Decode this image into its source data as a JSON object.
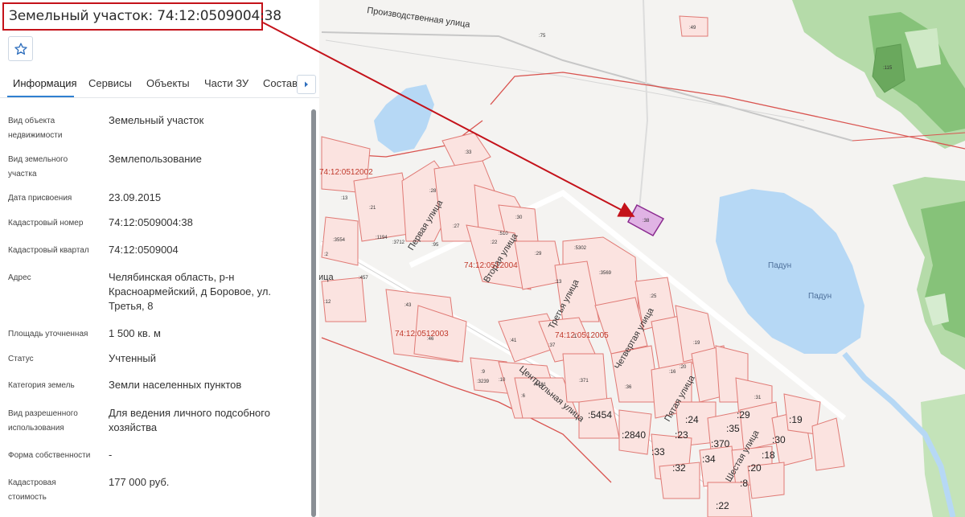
{
  "header": {
    "title": "Земельный участок: 74:12:0509004:38",
    "favorite_icon": "star-outline-icon"
  },
  "tabs": [
    {
      "label": "Информация",
      "active": true
    },
    {
      "label": "Сервисы",
      "active": false
    },
    {
      "label": "Объекты",
      "active": false
    },
    {
      "label": "Части ЗУ",
      "active": false
    },
    {
      "label": "Состав",
      "active": false
    }
  ],
  "tabs_scroll_icon": "chevron-right-icon",
  "info": [
    {
      "label": "Вид объекта недвижимости",
      "value": "Земельный участок"
    },
    {
      "label": "Вид земельного участка",
      "value": "Землепользование"
    },
    {
      "label": "Дата присвоения",
      "value": "23.09.2015"
    },
    {
      "label": "Кадастровый номер",
      "value": "74:12:0509004:38"
    },
    {
      "label": "Кадастровый квартал",
      "value": "74:12:0509004"
    },
    {
      "label": "Адрес",
      "value": "Челябинская область, р-н Красноармейский, д Боровое, ул. Третья, 8"
    },
    {
      "label": "Площадь уточненная",
      "value": "1 500 кв. м"
    },
    {
      "label": "Статус",
      "value": "Учтенный"
    },
    {
      "label": "Категория земель",
      "value": "Земли населенных пунктов"
    },
    {
      "label": "Вид разрешенного использования",
      "value": "Для ведения личного подсобного хозяйства"
    },
    {
      "label": "Форма собственности",
      "value": "-"
    },
    {
      "label": "Кадастровая стоимость",
      "value": "177 000 руб."
    }
  ],
  "map": {
    "streets": {
      "proizv": "Производственная улица",
      "pervaya": "Первая улица",
      "vtoraya": "Вторая улица",
      "tretya": "Третья улица",
      "chetv": "Четвертая улица",
      "pyataya": "Пятая улица",
      "shestaya": "Шестая улица",
      "centr": "Центральная улица"
    },
    "lake": "Падун",
    "quarters": {
      "q2002": "74:12:0512002",
      "q2004": "74:12:0512004",
      "q2003": "74:12:0512003",
      "q2005": "74:12:0512005"
    },
    "highlighted_parcel": ":38",
    "parcels": {
      "p49": ":49",
      "p75": ":75",
      "p115": ":115",
      "p33": ":33",
      "p13": ":13",
      "p21": ":21",
      "p1194": ":1194",
      "p3712": ":3712",
      "p3554": ":3554",
      "p2": ":2",
      "p457": ":457",
      "p12": ":12",
      "p43": ":43",
      "p46": ":46",
      "p41": ":41",
      "p30": ":30",
      "p510": ":510",
      "p22": ":22",
      "p29": ":29",
      "p5302": ":5302",
      "p3569": ":3569",
      "p371": ":371",
      "p3239": ":3239",
      "p4121": ":4121",
      "p5454": ":5454",
      "p2840": ":2840",
      "p24": ":24",
      "p23": ":23",
      "p370": ":370",
      "p35": ":35",
      "p29b": ":29",
      "p19": ":19",
      "p30b": ":30",
      "p18": ":18",
      "p20": ":20",
      "p8": ":8",
      "p34": ":34",
      "p33b": ":33",
      "p32": ":32",
      "p22b": ":22",
      "p16": ":16",
      "p37": ":37",
      "p36": ":36",
      "p25": ":25",
      "p31": ":31",
      "p19b": ":19",
      "p20b": ":20",
      "p9": ":9",
      "p10": ":10",
      "p6": ":6",
      "p1": ":1",
      "p13b": ":13",
      "p28": ":28",
      "p27": ":27",
      "p95": ":95"
    },
    "fragment_label": "ица"
  },
  "colors": {
    "accent": "#2f80d1",
    "highlight_border": "#c4121a",
    "parcel_border": "#d9534f",
    "parcel_fill": "#fbe3e0",
    "selected_parcel": "#d48fd6",
    "water": "#b6d8f5",
    "forest": "#a7d39a"
  }
}
